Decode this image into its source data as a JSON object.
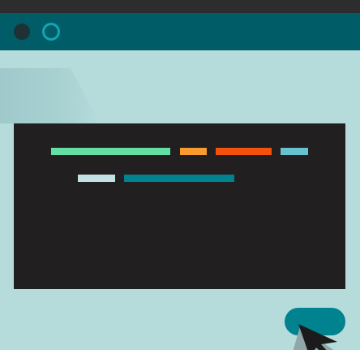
{
  "window": {
    "controls": [
      {
        "name": "dark-dot",
        "color": "#1e3135"
      },
      {
        "name": "ring-dot",
        "color": "#12a5b6"
      }
    ]
  },
  "code_panel": {
    "lines": [
      [
        {
          "color": "#63dfa3"
        },
        {
          "color": "#f99c30"
        },
        {
          "color": "#f4510c"
        },
        {
          "color": "#67c1cf"
        }
      ],
      [
        {
          "color": "#c3e1e4"
        },
        {
          "color": "#00828f"
        }
      ]
    ]
  },
  "icons": {
    "cursor": "arrow-cursor-icon"
  },
  "colors": {
    "background": "#b5dbdb",
    "title_bar": "#005d67",
    "top_strip": "#2d2d2d",
    "code_bg": "#221f21",
    "button": "#00828f"
  }
}
